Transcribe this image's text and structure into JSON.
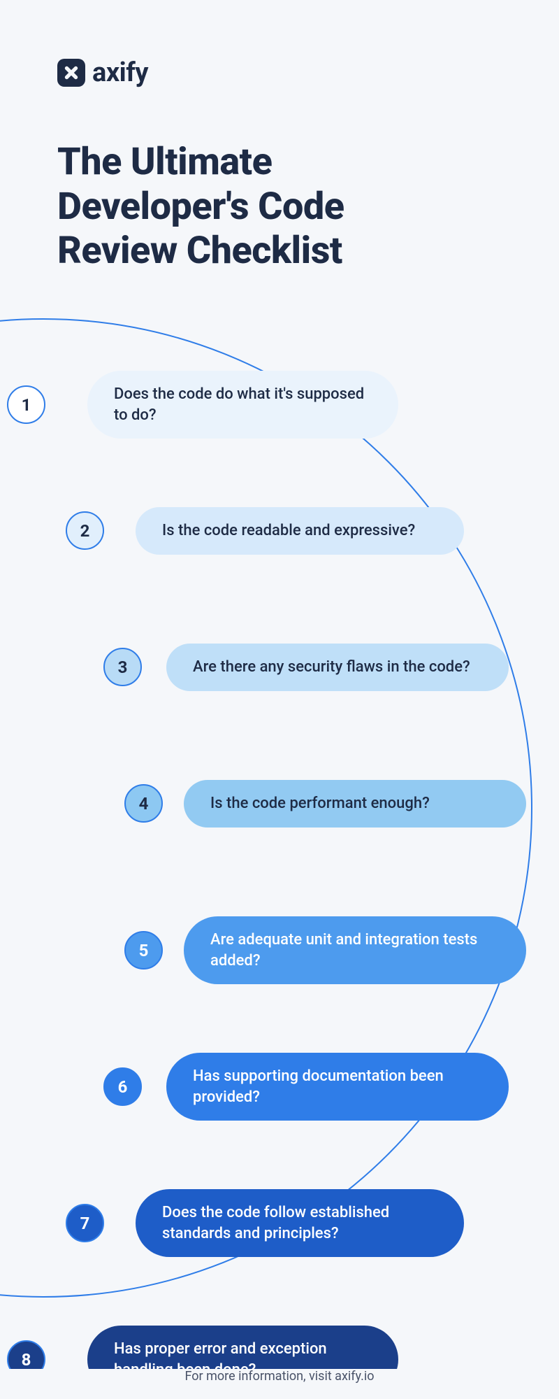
{
  "brand": {
    "name": "axify"
  },
  "title": "The Ultimate Developer's Code Review Checklist",
  "checklist": [
    {
      "num": "1",
      "text": "Does the code do what it's supposed to do?"
    },
    {
      "num": "2",
      "text": "Is the code readable and expressive?"
    },
    {
      "num": "3",
      "text": "Are there any security flaws in the code?"
    },
    {
      "num": "4",
      "text": "Is the code performant enough?"
    },
    {
      "num": "5",
      "text": "Are adequate unit and integration tests added?"
    },
    {
      "num": "6",
      "text": "Has supporting documentation been provided?"
    },
    {
      "num": "7",
      "text": "Does the code follow established standards and principles?"
    },
    {
      "num": "8",
      "text": "Has proper error and exception handling been done?"
    }
  ],
  "footer": "For more information, visit axify.io"
}
